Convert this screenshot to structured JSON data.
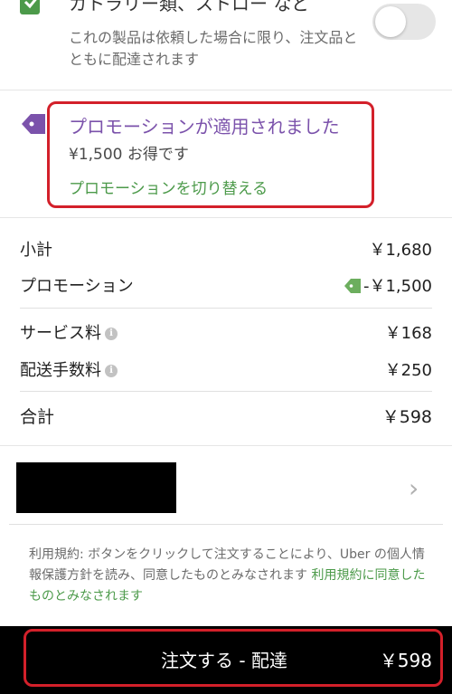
{
  "utensils": {
    "title": "カトラリー類、ストロー など",
    "description": "これの製品は依頼した場合に限り、注文品とともに配達されます",
    "toggle_on": false
  },
  "promotion": {
    "title": "プロモーションが適用されました",
    "savings": "¥1,500 お得です",
    "switch_link": "プロモーションを切り替える"
  },
  "summary": {
    "subtotal_label": "小計",
    "subtotal_value": "￥1,680",
    "promotion_label": "プロモーション",
    "promotion_value": "-￥1,500",
    "service_fee_label": "サービス料",
    "service_fee_value": "￥168",
    "delivery_fee_label": "配送手数料",
    "delivery_fee_value": "￥250",
    "total_label": "合計",
    "total_value": "￥598"
  },
  "terms": {
    "text": "利用規約: ボタンをクリックして注文することにより、Uber の個人情報保護方針を読み、同意したものとみなされます",
    "link": "利用規約に同意したものとみなされます"
  },
  "order_button": {
    "label": "注文する - 配達",
    "price": "￥598"
  },
  "colors": {
    "promo_purple": "#7b52ab",
    "link_green": "#4c9a4a",
    "highlight_red": "#d3202a",
    "bar_black": "#000000"
  },
  "icons": {
    "utensils": "leaf-icon",
    "promotion": "tag-icon",
    "info": "info-icon",
    "payment_chevron": "chevron-right-icon"
  }
}
